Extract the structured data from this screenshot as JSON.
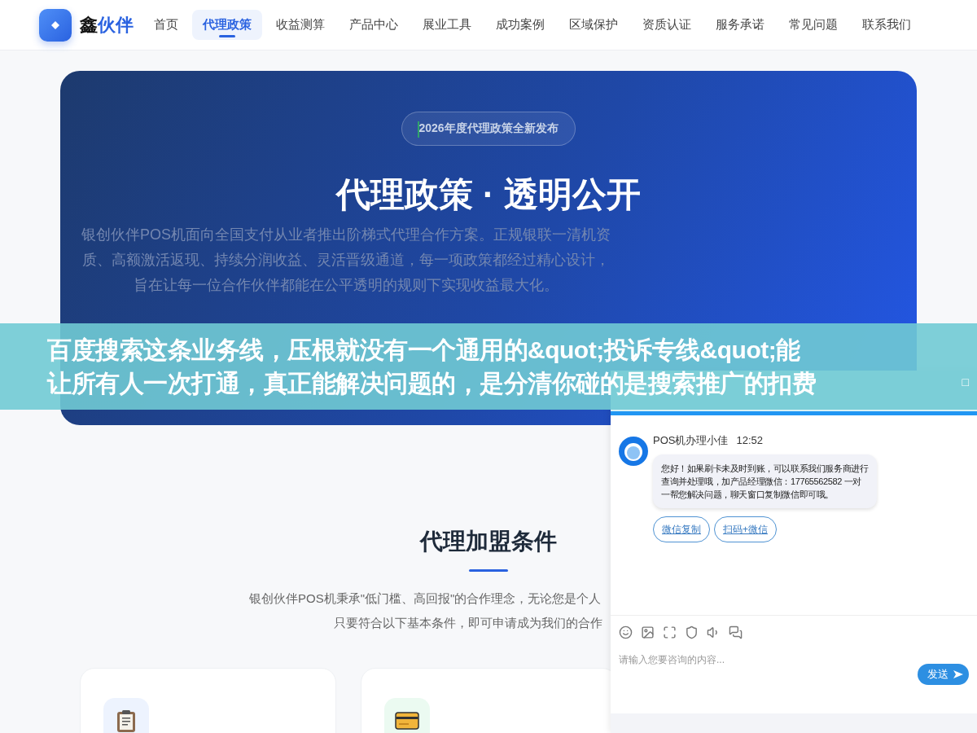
{
  "header": {
    "logo": {
      "mark": "鑫",
      "rest": "伙伴"
    },
    "nav": [
      {
        "label": "首页",
        "selected": false
      },
      {
        "label": "代理政策",
        "selected": true
      },
      {
        "label": "收益测算",
        "selected": false
      },
      {
        "label": "产品中心",
        "selected": false
      },
      {
        "label": "展业工具",
        "selected": false
      },
      {
        "label": "成功案例",
        "selected": false
      },
      {
        "label": "区域保护",
        "selected": false
      },
      {
        "label": "资质认证",
        "selected": false
      },
      {
        "label": "服务承诺",
        "selected": false
      },
      {
        "label": "常见问题",
        "selected": false
      },
      {
        "label": "联系我们",
        "selected": false
      }
    ]
  },
  "hero": {
    "badge": "2026年度代理政策全新发布",
    "title": "代理政策 · 透明公开",
    "intro": "银创伙伴POS机面向全国支付从业者推出阶梯式代理合作方案。正规银联一清机资质、高额激活返现、持续分润收益、灵活晋级通道，每一项政策都经过精心设计，旨在让每一位合作伙伴都能在公平透明的规则下实现收益最大化。"
  },
  "section": {
    "title": "代理加盟条件",
    "intro": [
      "银创伙伴POS机秉承\"低门槛、高回报\"的合作理念，无论您是个人",
      "只要符合以下基本条件，即可申请成为我们的合作"
    ],
    "cards": [
      {
        "kind": "clipboard"
      },
      {
        "kind": "bankcard"
      }
    ]
  },
  "overlay": {
    "lines": [
      "百度搜索这条业务线，压根就没有一个通用的&quot;投诉专线&quot;能",
      "让所有人一次打通，真正能解决问题的，是分清你碰的是搜索推广的扣费"
    ]
  },
  "chat": {
    "minimize": "□",
    "agent": {
      "name": "POS机办理小佳",
      "time": "12:52"
    },
    "message": "您好！如果刷卡未及时到账，可以联系我们服务商进行查询并处理哦，加产品经理微信：17765562582 一对一帮您解决问题，聊天窗口复制微信即可哦。",
    "actions": [
      "微信复制",
      "扫码+微信"
    ],
    "input": {
      "placeholder": "请输入您要咨询的内容..."
    },
    "send": "发送"
  }
}
